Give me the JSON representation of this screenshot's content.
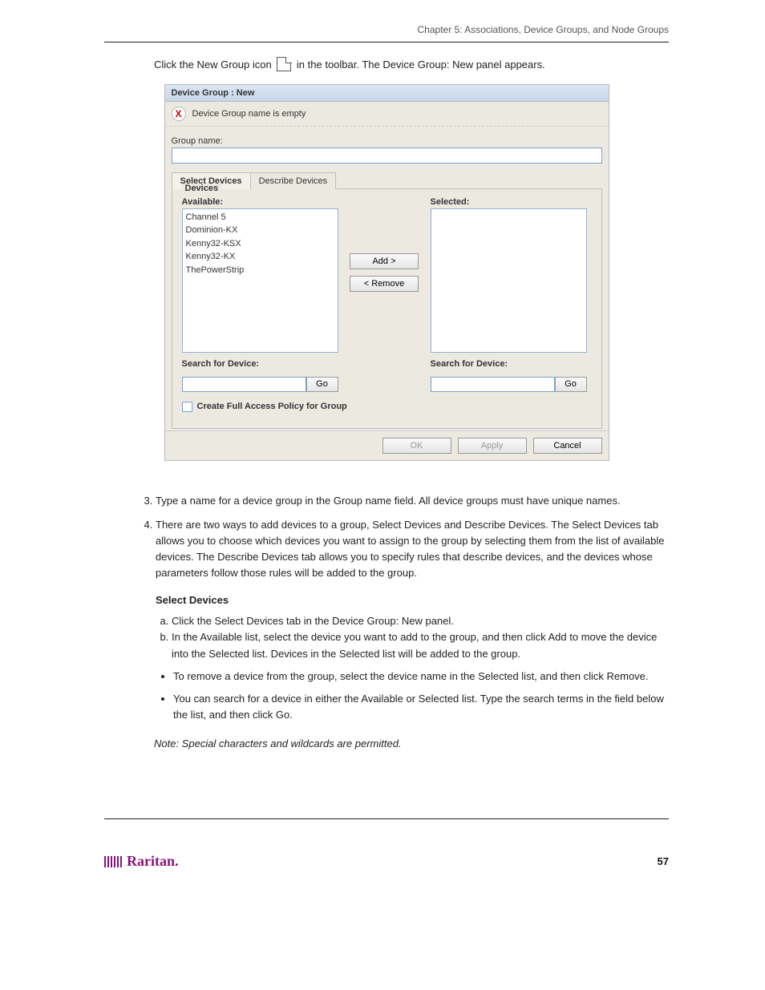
{
  "chapter_header": "Chapter 5: Associations, Device Groups, and Node Groups",
  "intro_before_icon": "Click the New Group icon",
  "intro_after_icon": "in the toolbar. The Device Group: New panel appears.",
  "dialog": {
    "title": "Device Group : New",
    "error_msg": "Device Group name is empty",
    "group_name_label": "Group name:",
    "group_name_value": "",
    "tabs": {
      "select": "Select Devices",
      "describe": "Describe Devices"
    },
    "fieldset_legend": "Devices",
    "available_label": "Available:",
    "selected_label": "Selected:",
    "available_items": [
      "Channel 5",
      "Dominion-KX",
      "Kenny32-KSX",
      "Kenny32-KX",
      "ThePowerStrip"
    ],
    "add_btn": "Add  >",
    "remove_btn": "<  Remove",
    "search_label_left": "Search for Device:",
    "search_label_right": "Search for Device:",
    "go_btn": "Go",
    "checkbox_label": "Create Full Access Policy for Group",
    "ok": "OK",
    "apply": "Apply",
    "cancel": "Cancel"
  },
  "steps": {
    "s3": "Type a name for a device group in the Group name field. All device groups must have unique names.",
    "s4": "There are two ways to add devices to a group, Select Devices and Describe Devices. The Select Devices tab allows you to choose which devices you want to assign to the group by selecting them from the list of available devices. The Describe Devices tab allows you to specify rules that describe devices, and the devices whose parameters follow those rules will be added to the group.",
    "select_heading": "Select Devices",
    "s4a": "Click the Select Devices tab in the Device Group: New panel.",
    "s4b": "In the Available list, select the device you want to add to the group, and then click Add to move the device into the Selected list. Devices in the Selected list will be added to the group.",
    "s4b_sub1": "To remove a device from the group, select the device name in the Selected list, and then click Remove.",
    "s4b_sub2": "You can search for a device in either the Available or Selected list. Type the search terms in the field below the list, and then click Go."
  },
  "note": "Note: Special characters and wildcards are permitted.",
  "page_number": "57",
  "logo_text": "Raritan."
}
